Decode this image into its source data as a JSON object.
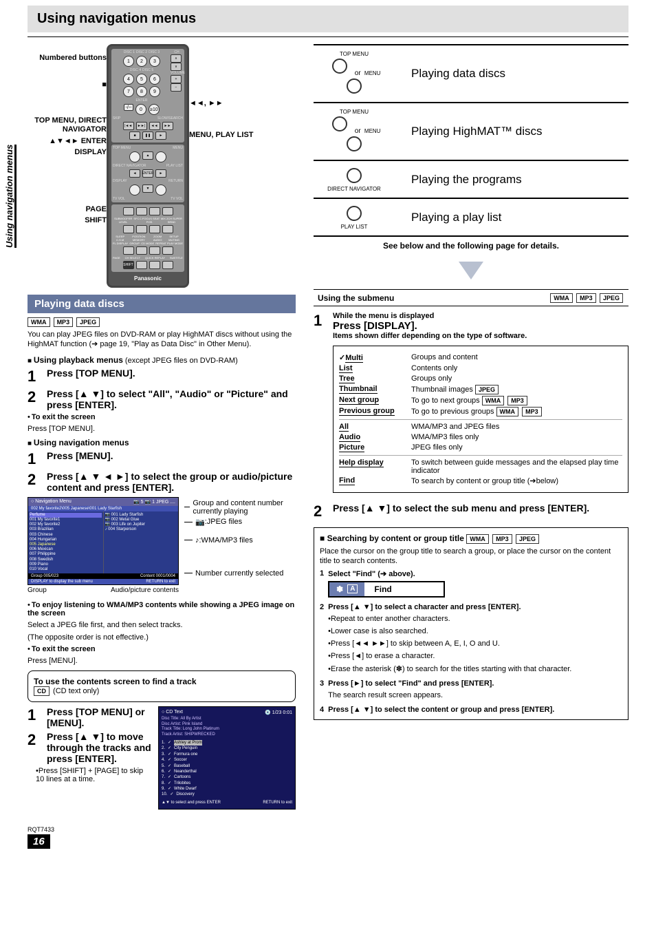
{
  "page": {
    "title": "Using navigation menus",
    "side_tab": "Using navigation menus",
    "footer_code": "RQT7433",
    "page_number": "16"
  },
  "remote": {
    "labels_left": {
      "numbered": "Numbered buttons",
      "stop": "■",
      "top_menu": "TOP MENU, DIRECT NAVIGATOR",
      "arrows_enter": "▲▼◄► ENTER",
      "display": "DISPLAY",
      "page": "PAGE",
      "shift": "SHIFT"
    },
    "labels_right": {
      "seek": "◄◄, ►►",
      "menu": "MENU, PLAY LIST"
    },
    "brand": "Panasonic",
    "rows": {
      "discs": [
        "DISC 1",
        "DISC 2",
        "DISC 3",
        "DISC 4",
        "DISC 5"
      ],
      "nums": [
        "1",
        "2",
        "3",
        "4",
        "5",
        "6",
        "7",
        "8",
        "9",
        "0",
        "≥10"
      ],
      "ch": "CH",
      "vol": "VOLUME",
      "enter_lbl": "ENTER",
      "skip": "SKIP",
      "slow": "SLOW/SEARCH",
      "top_menu": "TOP MENU",
      "menu": "MENU",
      "direct_nav": "DIRECT NAVIGATOR",
      "play_list": "PLAY LIST",
      "display": "DISPLAY",
      "return": "RETURN",
      "tv_vol": "TV VOL",
      "row_a": [
        "SUBWOOFER LEVEL",
        "SFC",
        "C.FOCUS SEAT POS.",
        "MIX 2CH SUPER SRND",
        "MULTI RE-MASTER"
      ],
      "row_b": [
        "SLEEP C.S.M",
        "POSITION MEMORY",
        "ZOOM AUDIO",
        "SETUP MUTING"
      ],
      "row_c": [
        "FL DISPLAY",
        "GROUP",
        "CD MODE",
        "REPEAT PLAY MODE"
      ],
      "row_d": [
        "PAGE",
        "CH SELECT",
        "QUICK REPLAY",
        "SUBTITLE"
      ]
    }
  },
  "right_rows": [
    {
      "btns": [
        {
          "lbl": "TOP MENU"
        },
        {
          "sep": "or"
        },
        {
          "lbl": "MENU"
        }
      ],
      "title": "Playing data discs"
    },
    {
      "btns": [
        {
          "lbl": "TOP MENU"
        },
        {
          "sep": "or"
        },
        {
          "lbl": "MENU"
        }
      ],
      "title": "Playing HighMAT™ discs"
    },
    {
      "btns": [
        {
          "lbl": "DIRECT NAVIGATOR",
          "single": true
        }
      ],
      "title": "Playing the programs"
    },
    {
      "btns": [
        {
          "lbl": "PLAY LIST",
          "single": true
        }
      ],
      "title": "Playing a play list"
    }
  ],
  "see_below": "See below and the following page for details.",
  "section_bar": "Playing data discs",
  "badges_main": [
    "WMA",
    "MP3",
    "JPEG"
  ],
  "intro_para": "You can play JPEG files on DVD-RAM or play HighMAT discs without using the HighMAT function (➔ page 19, \"Play as Data Disc\" in Other Menu).",
  "playback": {
    "heading": "Using playback menus",
    "heading_note": " (except JPEG files on DVD-RAM)",
    "step1": "Press [TOP MENU].",
    "step2": "Press [▲ ▼] to select \"All\", \"Audio\" or \"Picture\" and press [ENTER].",
    "exit_l": "To exit the screen",
    "exit_t": "Press [TOP MENU]."
  },
  "navmenus": {
    "heading": "Using navigation menus",
    "step1": "Press [MENU].",
    "step2": "Press [▲ ▼ ◄ ►] to select the group or audio/picture content and press [ENTER]."
  },
  "nav_menu_widget": {
    "title": "Navigation  Menu",
    "path": "002 My favorite2\\005 Japanese\\001 Lady Starfish",
    "left_pane_head": "Perfume",
    "left_pane": [
      "001 My favorite1",
      "002 My favorite2",
      "003 Brazilian",
      "003 Chinese",
      "004 Hungarian",
      "005 Japanese",
      "006 Mexican",
      "007 Philippine",
      "008 Swedish",
      "009 Piano",
      "010 Vocal"
    ],
    "right_pane": [
      "001 Lady Starfish",
      "002 Metal Glue",
      "003 Life on Jupiter",
      "004 Starperson"
    ],
    "status_l": "Group   005/023",
    "status_r": "Content  0001/0004",
    "foot_l": "DISPLAY  to display the sub menu",
    "foot_r": "RETURN  to exit",
    "annot_top": "Group and content number currently playing",
    "annot_jpeg": ":JPEG files",
    "annot_wma": ":WMA/MP3 files",
    "annot_bottom": "Number currently selected",
    "label_group": "Group",
    "label_contents": "Audio/picture contents"
  },
  "enjoy": {
    "head": "To enjoy listening to WMA/MP3 contents while showing a JPEG image on the screen",
    "l1": "Select a JPEG file first, and then select tracks.",
    "l2": "(The opposite order is not effective.)",
    "exit_l": "To exit the screen",
    "exit_t": "Press [MENU]."
  },
  "cd_box": {
    "head": "To use the contents screen to find a track",
    "badge": "CD",
    "note": " (CD text only)",
    "step1": "Press [TOP MENU] or [MENU].",
    "step2": "Press [▲ ▼] to move through the tracks and press [ENTER].",
    "tip": "Press [SHIFT] + [PAGE] to skip 10 lines at a time.",
    "screen": {
      "title": "CD Text",
      "disc_no": "1/23   0:01",
      "meta": [
        "Disc Title:   All By Artist",
        "Disc Artist:  Pink Island",
        "Track Title:  Long John Platinum",
        "Track Artist: SHIPWRECKED"
      ],
      "tracks": [
        "Ashley at Prom",
        "City Penguin",
        "Formura one",
        "Soccer",
        "Baseball",
        "Neanderthal",
        "Cartoons",
        "Trilobites",
        "White Dwarf",
        "Discovery"
      ],
      "foot_l": "▲▼ to select and press  ENTER",
      "foot_r": "RETURN  to exit"
    }
  },
  "submenu": {
    "title": "Using the submenu",
    "badges": [
      "WMA",
      "MP3",
      "JPEG"
    ],
    "step1_l1": "While the menu is displayed",
    "step1_l2": "Press [DISPLAY].",
    "step1_l3": "Items shown differ depending on the type of software.",
    "items": [
      {
        "l": "Multi",
        "r": "Groups and content",
        "chk": true
      },
      {
        "l": "List",
        "r": "Contents only"
      },
      {
        "l": "Tree",
        "r": "Groups only"
      },
      {
        "l": "Thumbnail",
        "r": "Thumbnail images",
        "badges": [
          "JPEG"
        ]
      },
      {
        "l": "Next group",
        "r": "To go to next groups",
        "badges": [
          "WMA",
          "MP3"
        ]
      },
      {
        "l": "Previous group",
        "r": "To go to previous groups",
        "badges": [
          "WMA",
          "MP3"
        ]
      },
      {
        "div": true
      },
      {
        "l": "All",
        "r": "WMA/MP3 and JPEG files"
      },
      {
        "l": "Audio",
        "r": "WMA/MP3 files only"
      },
      {
        "l": "Picture",
        "r": "JPEG files only"
      },
      {
        "div": true
      },
      {
        "l": "Help display",
        "r": "To switch between guide messages and the elapsed play time indicator"
      },
      {
        "l": "Find",
        "r": "To search by content or group title (➔below)"
      }
    ],
    "step2": "Press [▲ ▼] to select the sub menu and press [ENTER]."
  },
  "search": {
    "title": "Searching by content or group title",
    "badges": [
      "WMA",
      "MP3",
      "JPEG"
    ],
    "intro": "Place the cursor on the group title to search a group, or place the cursor on the content title to search contents.",
    "s1": "Select \"Find\" (➔ above).",
    "find_l_ast": "✽",
    "find_l_a": "A",
    "find_r": "Find",
    "s2": "Press [▲ ▼] to select a character and press [ENTER].",
    "s2b": [
      "Repeat to enter another characters.",
      "Lower case is also searched.",
      "Press [◄◄ ►►] to skip between A, E, I, O and U.",
      "Press [◄] to erase a character.",
      "Erase the asterisk (✽) to search for the titles starting with that character."
    ],
    "s3": "Press [►] to select \"Find\" and press [ENTER].",
    "s3b": "The search result screen appears.",
    "s4": "Press [▲ ▼] to select the content or group and press [ENTER]."
  }
}
